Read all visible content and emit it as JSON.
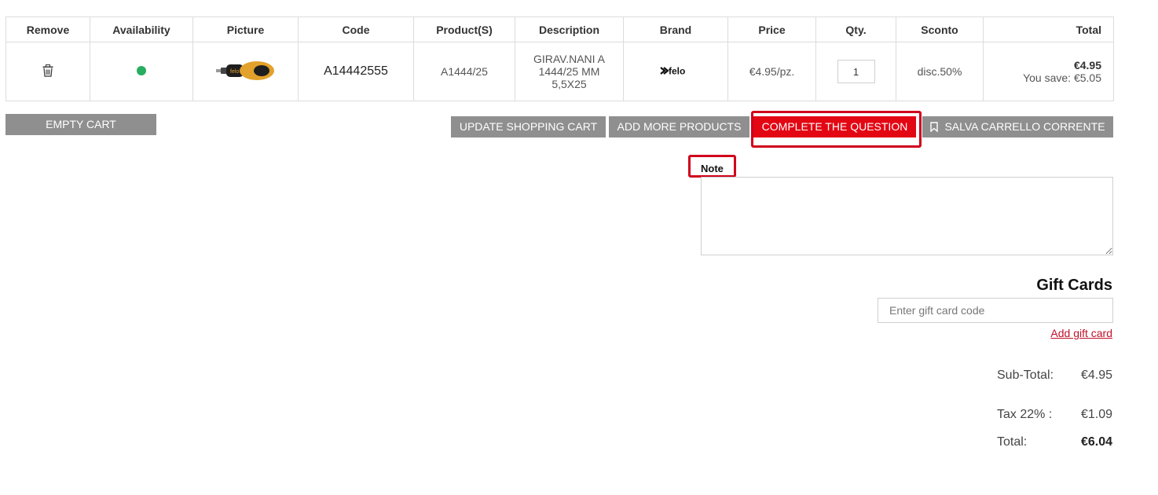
{
  "table": {
    "headers": [
      "Remove",
      "Availability",
      "Picture",
      "Code",
      "Product(S)",
      "Description",
      "Brand",
      "Price",
      "Qty.",
      "Sconto",
      "Total"
    ],
    "row": {
      "remove_icon": "trash-icon",
      "availability_color": "#27ae60",
      "picture": "screwdriver-image",
      "code": "A14442555",
      "product": "A1444/25",
      "description_lines": [
        "GIRAV.NANI A",
        "1444/25 MM",
        "5,5X25"
      ],
      "brand": "felo",
      "price": "€4.95/pz.",
      "qty": "1",
      "discount": "disc.50%",
      "total": "€4.95",
      "you_save": "You save: €5.05"
    }
  },
  "buttons": {
    "empty_cart": "EMPTY CART",
    "update_cart": "UPDATE SHOPPING CART",
    "add_more": "ADD MORE PRODUCTS",
    "complete_question": "COMPLETE THE QUESTION",
    "save_cart": "SALVA CARRELLO CORRENTE"
  },
  "note": {
    "label": "Note"
  },
  "gift_cards": {
    "title": "Gift Cards",
    "placeholder": "Enter gift card code",
    "add_link": "Add gift card"
  },
  "totals": {
    "subtotal_label": "Sub-Total:",
    "subtotal_value": "€4.95",
    "tax_label": "Tax 22% :",
    "tax_value": "€1.09",
    "total_label": "Total:",
    "total_value": "€6.04"
  },
  "colors": {
    "accent_red": "#e30613",
    "button_gray": "#8f8f8f",
    "highlight_red": "#d0021b",
    "available_green": "#27ae60"
  }
}
